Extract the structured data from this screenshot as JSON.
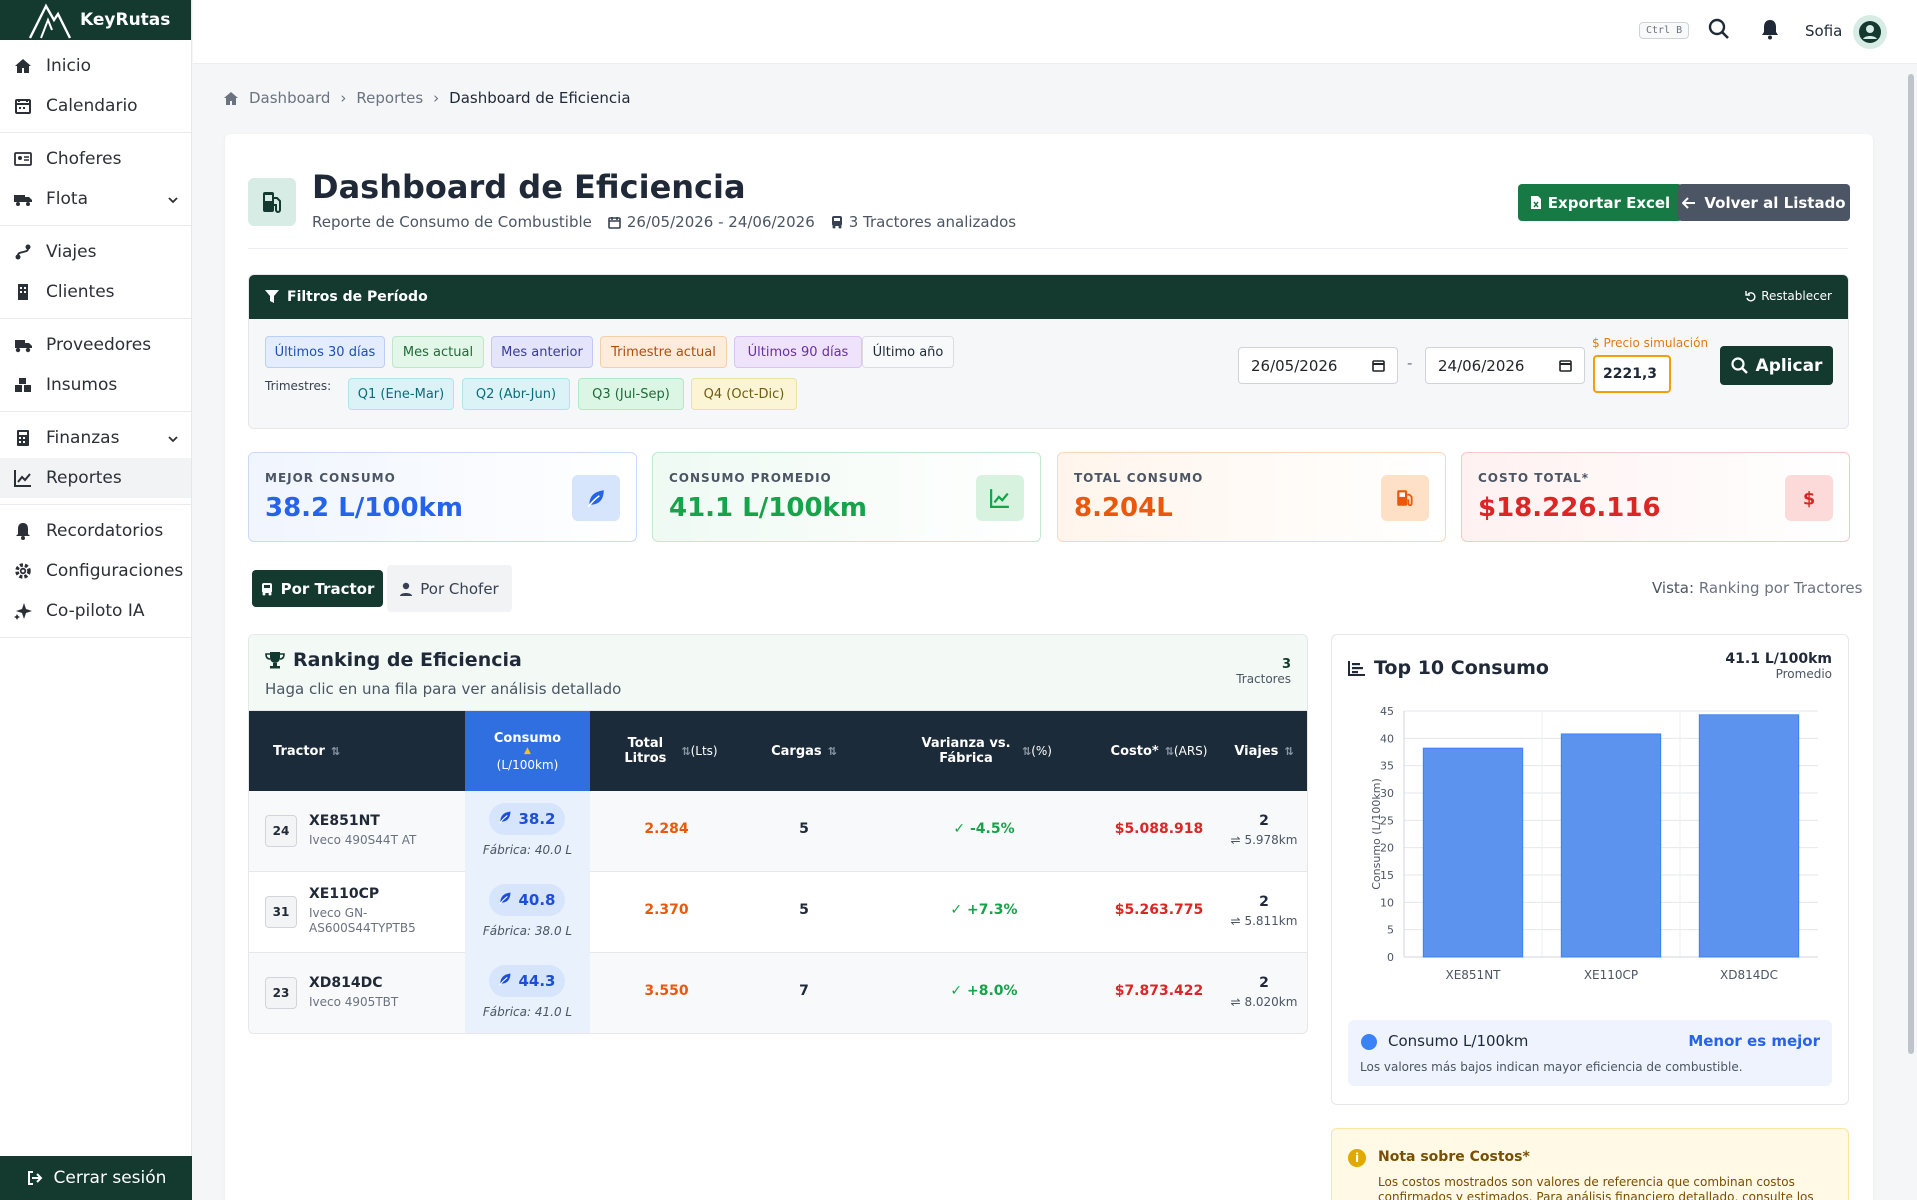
{
  "brand": {
    "name": "KeyRutas"
  },
  "sidebar": {
    "groups": [
      [
        {
          "label": "Inicio",
          "icon": "home-icon"
        },
        {
          "label": "Calendario",
          "icon": "calendar-icon"
        }
      ],
      [
        {
          "label": "Choferes",
          "icon": "id-card-icon"
        },
        {
          "label": "Flota",
          "icon": "truck-icon",
          "expandable": true
        }
      ],
      [
        {
          "label": "Viajes",
          "icon": "route-icon"
        },
        {
          "label": "Clientes",
          "icon": "building-icon"
        }
      ],
      [
        {
          "label": "Proveedores",
          "icon": "shipping-icon"
        },
        {
          "label": "Insumos",
          "icon": "boxes-icon"
        }
      ],
      [
        {
          "label": "Finanzas",
          "icon": "calculator-icon",
          "expandable": true
        },
        {
          "label": "Reportes",
          "icon": "chart-line-icon",
          "active": true
        }
      ],
      [
        {
          "label": "Recordatorios",
          "icon": "bell-icon"
        },
        {
          "label": "Configuraciones",
          "icon": "gear-icon"
        },
        {
          "label": "Co-piloto IA",
          "icon": "sparkle-icon"
        }
      ]
    ],
    "logout_label": "Cerrar sesión"
  },
  "topbar": {
    "shortcut": "Ctrl B",
    "user": "Sofia"
  },
  "breadcrumb": {
    "home": "Dashboard",
    "parent": "Reportes",
    "current": "Dashboard de Eficiencia"
  },
  "header": {
    "title": "Dashboard de Eficiencia",
    "subtitle": "Reporte de Consumo de Combustible",
    "range": "26/05/2026 - 24/06/2026",
    "tractors": "3 Tractores analizados",
    "export_label": "Exportar Excel",
    "back_label": "Volver al Listado"
  },
  "filters": {
    "title": "Filtros de Período",
    "reset_label": "Restablecer",
    "presets": [
      "Últimos 30 días",
      "Mes actual",
      "Mes anterior",
      "Trimestre actual",
      "Últimos 90 días",
      "Último año"
    ],
    "quarters_label": "Trimestres:",
    "quarters": [
      "Q1 (Ene-Mar)",
      "Q2 (Abr-Jun)",
      "Q3 (Jul-Sep)",
      "Q4 (Oct-Dic)"
    ],
    "date_from": "26/05/2026",
    "date_to": "24/06/2026",
    "date_sep": "-",
    "price_label": "$ Precio simulación",
    "price_value": "2221,3",
    "apply_label": "Aplicar"
  },
  "kpis": [
    {
      "label": "MEJOR CONSUMO",
      "value": "38.2 L/100km",
      "color": "#2563eb",
      "icon": "leaf-icon"
    },
    {
      "label": "CONSUMO PROMEDIO",
      "value": "41.1 L/100km",
      "color": "#16a34a",
      "icon": "chart-line-icon"
    },
    {
      "label": "TOTAL CONSUMO",
      "value": "8.204L",
      "color": "#ea580c",
      "icon": "fuel-pump-icon"
    },
    {
      "label": "COSTO TOTAL*",
      "value": "$18.226.116",
      "color": "#dc2626",
      "icon": "dollar-icon"
    }
  ],
  "tabs": {
    "tractor": "Por Tractor",
    "chofer": "Por Chofer"
  },
  "vista": {
    "label": "Vista:",
    "value": "Ranking por Tractores"
  },
  "ranking": {
    "title": "Ranking de Eficiencia",
    "hint": "Haga clic en una fila para ver análisis detallado",
    "count": "3",
    "count_label": "Tractores",
    "columns": {
      "tractor": "Tractor",
      "consumo": "Consumo",
      "consumo_unit": "(L/100km)",
      "total_litros": "Total Litros",
      "total_unit": "(Lts)",
      "cargas": "Cargas",
      "varianza": "Varianza vs. Fábrica",
      "varianza_unit": "(%)",
      "costo": "Costo*",
      "costo_unit": "(ARS)",
      "viajes": "Viajes"
    },
    "rows": [
      {
        "num": "24",
        "name": "XE851NT",
        "model": "Iveco 490S44T AT",
        "consumo": "38.2",
        "fabrica": "Fábrica: 40.0 L",
        "litros": "2.284",
        "cargas": "5",
        "varianza": "-4.5%",
        "costo": "$5.088.918",
        "viajes": "2",
        "km": "5.978km"
      },
      {
        "num": "31",
        "name": "XE110CP",
        "model": "Iveco GN-AS600S44TYPTB5",
        "consumo": "40.8",
        "fabrica": "Fábrica: 38.0 L",
        "litros": "2.370",
        "cargas": "5",
        "varianza": "+7.3%",
        "costo": "$5.263.775",
        "viajes": "2",
        "km": "5.811km"
      },
      {
        "num": "23",
        "name": "XD814DC",
        "model": "Iveco 4905TBT",
        "consumo": "44.3",
        "fabrica": "Fábrica: 41.0 L",
        "litros": "3.550",
        "cargas": "7",
        "varianza": "+8.0%",
        "costo": "$7.873.422",
        "viajes": "2",
        "km": "8.020km"
      }
    ]
  },
  "chart_panel": {
    "title": "Top 10 Consumo",
    "avg_value": "41.1 L/100km",
    "avg_label": "Promedio",
    "legend_name": "Consumo L/100km",
    "legend_better": "Menor es mejor",
    "legend_note": "Los valores más bajos indican mayor eficiencia de combustible."
  },
  "chart_data": {
    "type": "bar",
    "categories": [
      "XE851NT",
      "XE110CP",
      "XD814DC"
    ],
    "values": [
      38.2,
      40.8,
      44.3
    ],
    "ylabel": "Consumo (L/100km)",
    "ylim": [
      0,
      45
    ],
    "yticks": [
      0,
      5,
      10,
      15,
      20,
      25,
      30,
      35,
      40,
      45
    ],
    "grid": true,
    "bar_color": "#5b93ef"
  },
  "note": {
    "title": "Nota sobre Costos*",
    "text": "Los costos mostrados son valores de referencia que combinan costos confirmados y estimados. Para análisis financiero detallado, consulte los"
  }
}
